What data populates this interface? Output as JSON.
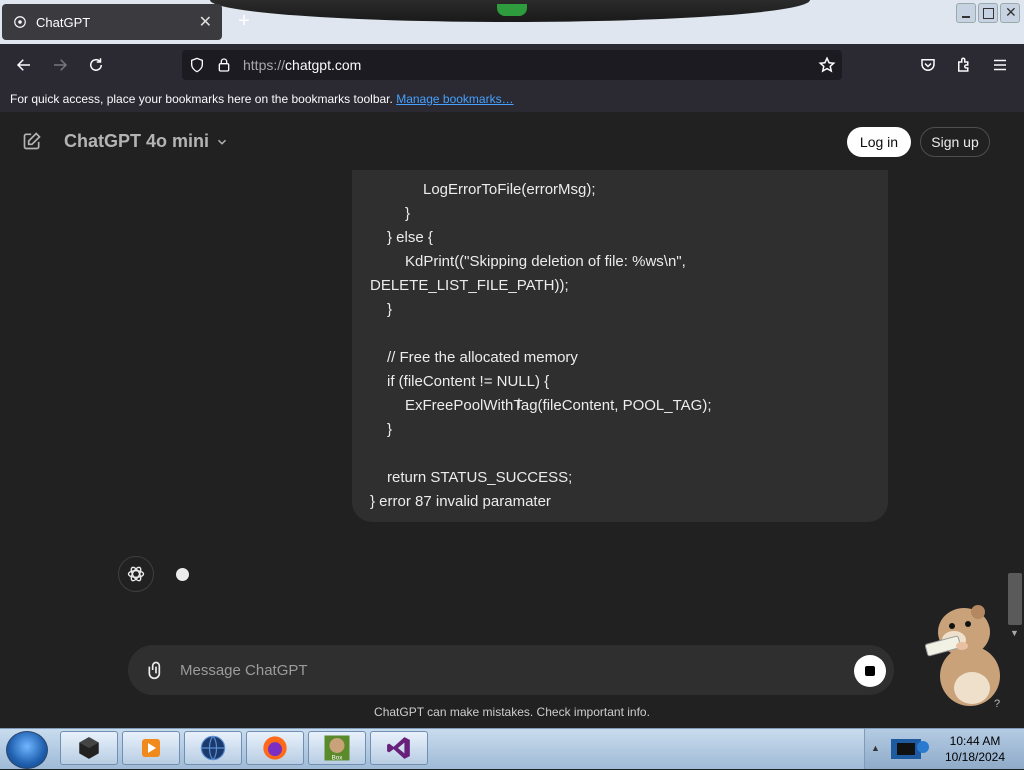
{
  "browser": {
    "tab_title": "ChatGPT",
    "url_protocol": "https://",
    "url_host": "chatgpt.com",
    "bookmarks_text": "For quick access, place your bookmarks here on the bookmarks toolbar.",
    "bookmarks_link": "Manage bookmarks…"
  },
  "chat": {
    "model_name": "ChatGPT 4o mini",
    "login_label": "Log in",
    "signup_label": "Sign up",
    "message_lines": [
      "LogErrorToFile(errorMsg);",
      "}",
      "} else {",
      "KdPrint((\"Skipping deletion of file: %ws\\n\",",
      "DELETE_LIST_FILE_PATH));",
      "}",
      "// Free the allocated memory",
      "if (fileContent != NULL) {",
      "ExFreePoolWithTag(fileContent, POOL_TAG);",
      "}",
      "return STATUS_SUCCESS;",
      "} error 87 invalid paramater"
    ],
    "composer_placeholder": "Message ChatGPT",
    "disclaimer": "ChatGPT can make mistakes. Check important info."
  },
  "taskbar": {
    "time": "10:44 AM",
    "date": "10/18/2024",
    "apps": [
      "cube-app",
      "media-player",
      "globe-app",
      "firefox",
      "box-app",
      "visual-studio"
    ]
  },
  "colors": {
    "background": "#212121",
    "bubble": "#2f2f2f",
    "link": "#45a1ff"
  }
}
